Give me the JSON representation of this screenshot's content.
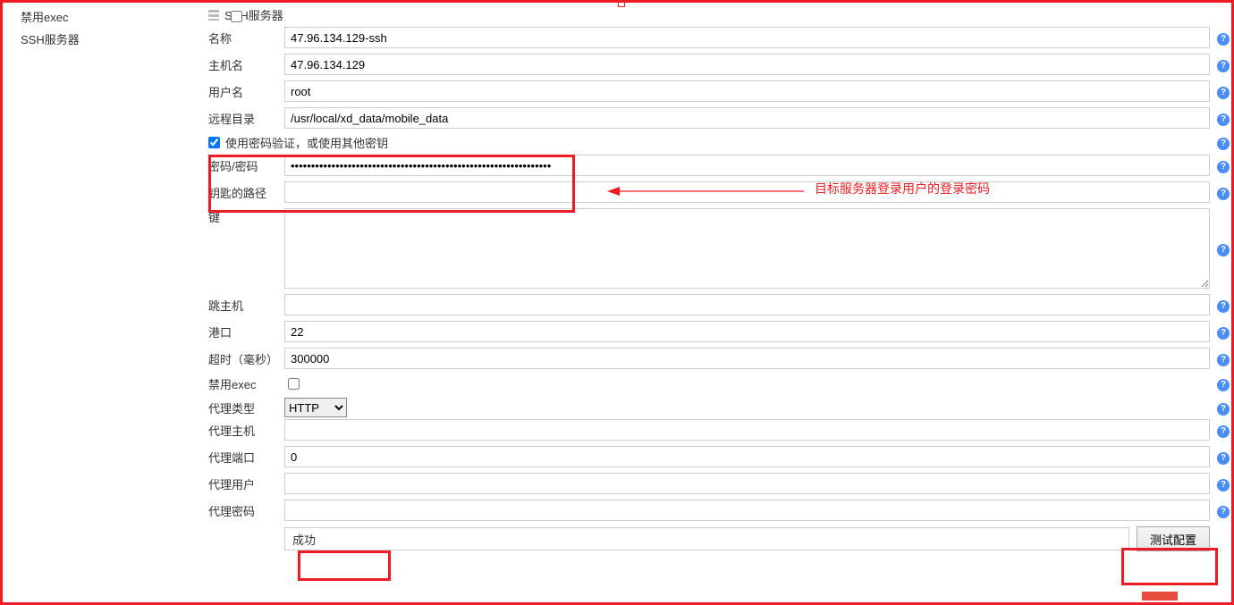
{
  "sidebar": {
    "disable_exec": "禁用exec",
    "ssh_servers": "SSH服务器"
  },
  "section": {
    "title": "SSH服务器"
  },
  "labels": {
    "name": "名称",
    "hostname": "主机名",
    "username": "用户名",
    "remote_dir": "远程目录",
    "use_password": "使用密码验证，或使用其他密钥",
    "password": "密码/密码",
    "key_path": "钥匙的路径",
    "key": "键",
    "jump_host": "跳主机",
    "port": "港口",
    "timeout": "超时（毫秒）",
    "disable_exec2": "禁用exec",
    "proxy_type": "代理类型",
    "proxy_host": "代理主机",
    "proxy_port": "代理端口",
    "proxy_user": "代理用户",
    "proxy_password": "代理密码"
  },
  "values": {
    "name": "47.96.134.129-ssh",
    "hostname": "47.96.134.129",
    "username": "root",
    "remote_dir": "/usr/local/xd_data/mobile_data",
    "use_password_checked": true,
    "password": "••••••••••••••••••••••••••••••••••••••••••••••••••••••••••••••••",
    "key_path": "",
    "key": "",
    "jump_host": "",
    "port": "22",
    "timeout": "300000",
    "disable_exec2_checked": false,
    "proxy_type_selected": "HTTP",
    "proxy_host": "",
    "proxy_port": "0",
    "proxy_user": "",
    "proxy_password": ""
  },
  "status": {
    "text": "成功",
    "button": "测试配置"
  },
  "annotation": {
    "text": "目标服务器登录用户的登录密码"
  },
  "help_glyph": "?"
}
